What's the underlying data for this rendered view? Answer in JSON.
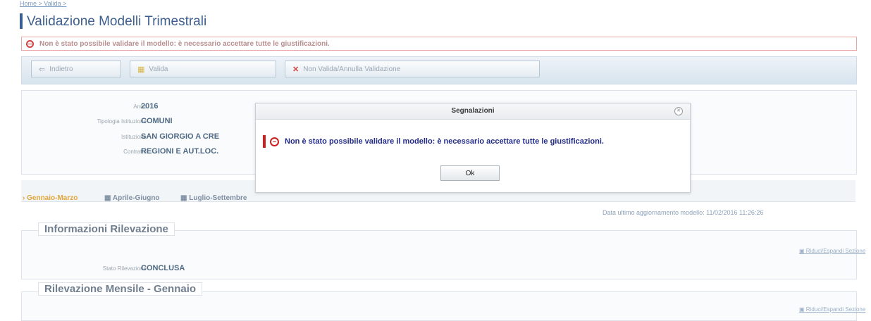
{
  "page": {
    "breadcrumb": "Home > Valida >",
    "title": "Validazione Modelli Trimestrali",
    "error_banner": "Non è stato possibile validare il modello: è necessario accettare tutte le giustificazioni.",
    "toolbar": {
      "back_label": "Indietro",
      "validate_label": "Valida",
      "invalidate_label": "Non Valida/Annulla Validazione"
    },
    "fields": [
      {
        "label": "Anno",
        "value": "2016"
      },
      {
        "label": "Tipologia Istituzione",
        "value": "COMUNI"
      },
      {
        "label": "Istituzione",
        "value": "SAN GIORGIO A CRE"
      },
      {
        "label": "Contratto",
        "value": "REGIONI E AUT.LOC."
      }
    ],
    "tabs": [
      "Gennaio-Marzo",
      "Aprile-Giugno",
      "Luglio-Settembre"
    ],
    "last_update_label": "Data ultimo aggiornamento modello:",
    "last_update_value": "11/02/2016 11:26:26",
    "sections": {
      "info_title": "Informazioni Rilevazione",
      "expand_label": "Riduci/Espandi Sezione",
      "status_label": "Stato Rilevazione",
      "status_value": "CONCLUSA",
      "monthly_title": "Rilevazione Mensile - Gennaio",
      "expand_label_2": "Riduci/Espandi Sezione"
    }
  },
  "modal": {
    "title": "Segnalazioni",
    "message": "Non è stato possibile validare il modello: è necessario accettare tutte le giustificazioni.",
    "ok_label": "Ok"
  },
  "colors": {
    "accent": "#3d5f8e",
    "error": "#cc2020",
    "active_tab": "#e0a63a"
  }
}
